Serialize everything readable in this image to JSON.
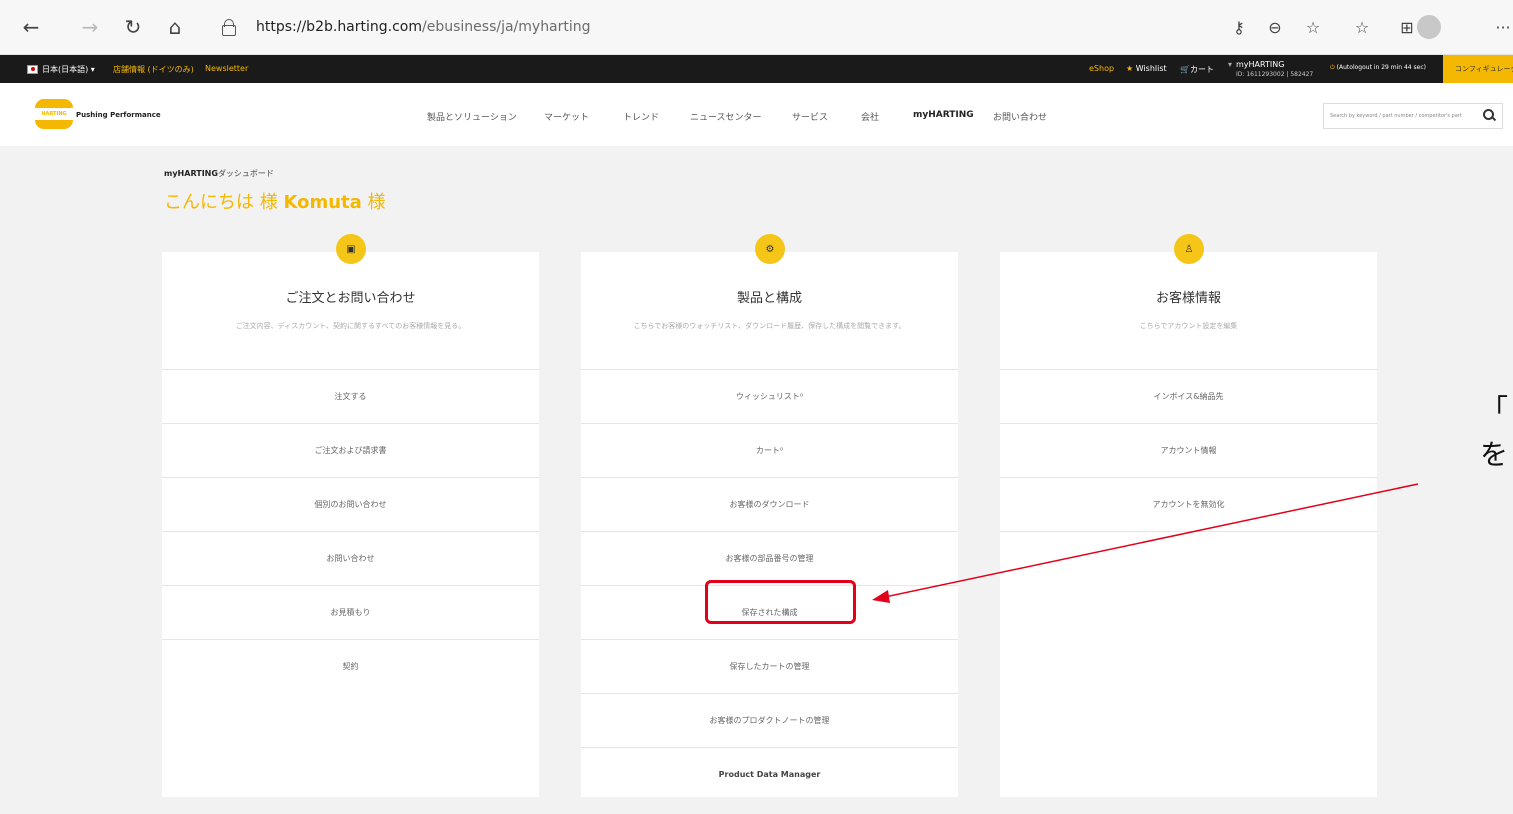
{
  "browser": {
    "url_host": "https://b2b.harting.com",
    "url_path": "/ebusiness/ja/myharting",
    "more_label": "···"
  },
  "topbar": {
    "language": "日本(日本語)",
    "info": "店舗情報 (ドイツのみ)",
    "newsletter": "Newsletter",
    "eshop": "eShop",
    "wishlist": "Wishlist",
    "cart": "カート",
    "account_name": "myHARTING",
    "account_id": "ID: 1611293002 | 582427",
    "autologout": "(Autologout in 29 min 44 sec)",
    "configurator": "コンフィギュレータ"
  },
  "header": {
    "logo_text": "HARTING",
    "tagline": "Pushing Performance",
    "menu": [
      "製品とソリューション",
      "マーケット",
      "トレンド",
      "ニュースセンター",
      "サービス",
      "会社",
      "myHARTING",
      "お問い合わせ"
    ],
    "search_placeholder": "Search by keyword / part number / competitor's part"
  },
  "main": {
    "breadcrumb_bold": "myHARTING",
    "breadcrumb_rest": "ダッシュボード",
    "greeting_prefix": "こんにちは 様",
    "greeting_name": "Komuta",
    "greeting_suffix": "様"
  },
  "cards": [
    {
      "title": "ご注文とお問い合わせ",
      "desc": "ご注文内容、ディスカウント、契約に関するすべてのお客様情報を見る。",
      "items": [
        "注文する",
        "ご注文および請求書",
        "個別のお問い合わせ",
        "お問い合わせ",
        "お見積もり",
        "契約"
      ]
    },
    {
      "title": "製品と構成",
      "desc": "こちらでお客様のウォッチリスト、ダウンロード履歴、保存した構成を閲覧できます。",
      "items": [
        "ウィッシュリスト⁰",
        "カート⁰",
        "お客様のダウンロード",
        "お客様の部品番号の管理",
        "保存された構成",
        "保存したカートの管理",
        "お客様のプロダクトノートの管理",
        "Product Data Manager"
      ]
    },
    {
      "title": "お客様情報",
      "desc": "こちらでアカウント設定を編集",
      "items": [
        "インボイス&納品先",
        "アカウント情報",
        "アカウントを無効化"
      ]
    }
  ],
  "annotation": {
    "line1": "「",
    "line2": "を"
  },
  "colors": {
    "brand_yellow": "#f5b800",
    "highlight_red": "#e2001a"
  }
}
